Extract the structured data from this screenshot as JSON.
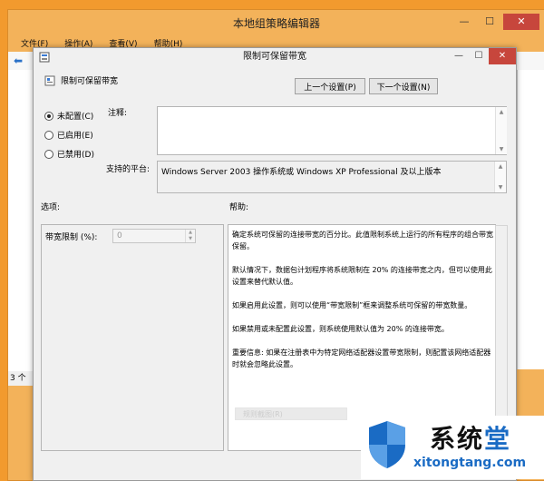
{
  "background_window": {
    "title": "本地组策略编辑器",
    "menu": [
      "文件(F)",
      "操作(A)",
      "查看(V)",
      "帮助(H)"
    ],
    "status_text": "3 个"
  },
  "dialog": {
    "title": "限制可保留带宽",
    "controls": {
      "minimize": "—",
      "maximize": "☐",
      "close": "✕"
    },
    "policy_name": "限制可保留带宽",
    "buttons": {
      "prev": "上一个设置(P)",
      "next": "下一个设置(N)"
    },
    "radios": [
      {
        "label": "未配置(C)",
        "checked": true
      },
      {
        "label": "已启用(E)",
        "checked": false
      },
      {
        "label": "已禁用(D)",
        "checked": false
      }
    ],
    "comment_label": "注释:",
    "comment_value": "",
    "platform_label": "支持的平台:",
    "platform_value": "Windows Server 2003 操作系统或 Windows XP Professional 及以上版本",
    "options_label": "选项:",
    "help_label": "帮助:",
    "bandwidth_label": "带宽限制 (%):",
    "bandwidth_value": "0",
    "help_paragraphs": [
      "确定系统可保留的连接带宽的百分比。此值限制系统上运行的所有程序的组合带宽保留。",
      "默认情况下，数据包计划程序将系统限制在 20% 的连接带宽之内，但可以使用此设置来替代默认值。",
      "如果启用此设置，则可以使用“带宽限制”框来调整系统可保留的带宽数量。",
      "如果禁用或未配置此设置，则系统使用默认值为 20% 的连接带宽。",
      "重要信息: 如果在注册表中为特定网络适配器设置带宽限制，则配置该网络适配器时就会忽略此设置。"
    ],
    "ghost_button": "规则截图(R)"
  },
  "watermark": {
    "name_black": "系统",
    "name_blue": "堂",
    "url": "xitongtang.com"
  },
  "colors": {
    "desktop": "#f29a2e",
    "dialog_bg": "#f0f0f0",
    "close_red": "#c7463c",
    "logo_blue": "#1a6bc4"
  }
}
